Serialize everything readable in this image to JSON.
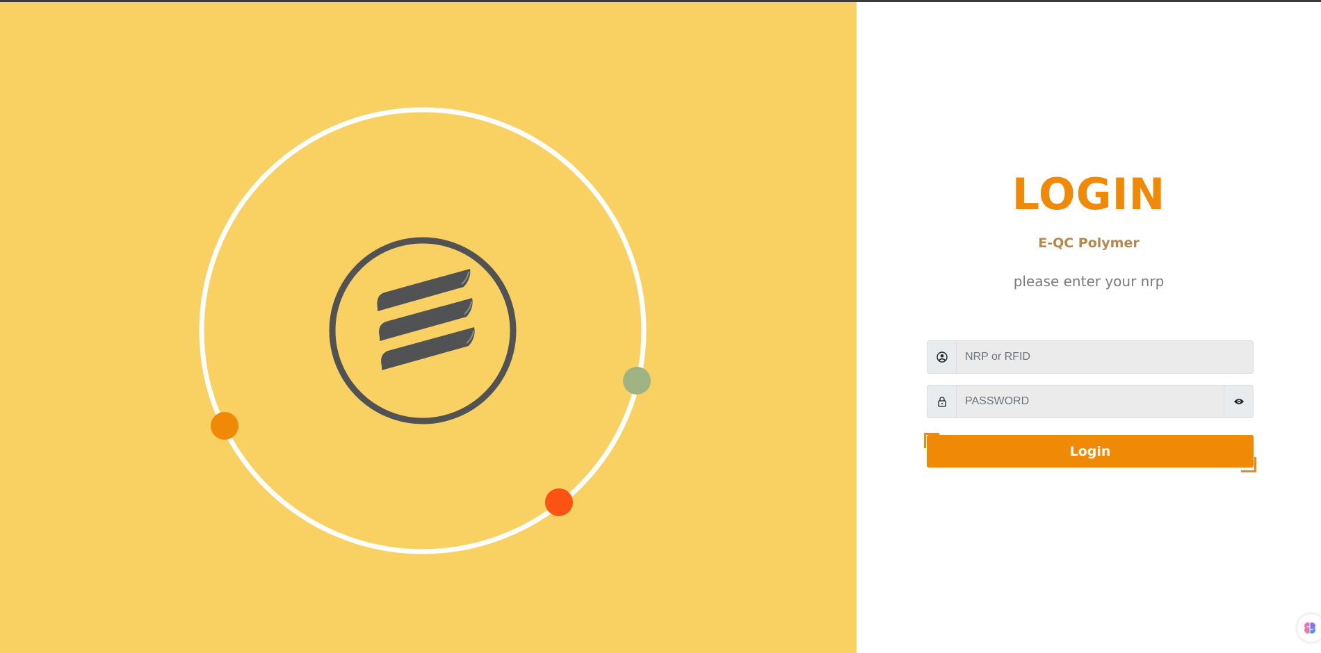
{
  "colors": {
    "left_background": "#f9d162",
    "accent": "#f08a06",
    "subtitle": "#b8874a",
    "logo": "#505254",
    "dot_green": "#a0b382",
    "dot_orange": "#f08a06",
    "dot_red": "#fc5315"
  },
  "header": {
    "title": "LOGIN",
    "app_name": "E-QC Polymer",
    "hint": "please enter your nrp"
  },
  "form": {
    "username": {
      "placeholder": "NRP or RFID",
      "value": "",
      "icon": "user-circle-icon"
    },
    "password": {
      "placeholder": "PASSWORD",
      "value": "",
      "icon": "lock-icon",
      "toggle_icon": "eye-icon"
    },
    "submit_label": "Login"
  },
  "branding": {
    "logo_icon": "company-logo-icon"
  },
  "floating": {
    "assistant_icon": "brain-icon"
  }
}
